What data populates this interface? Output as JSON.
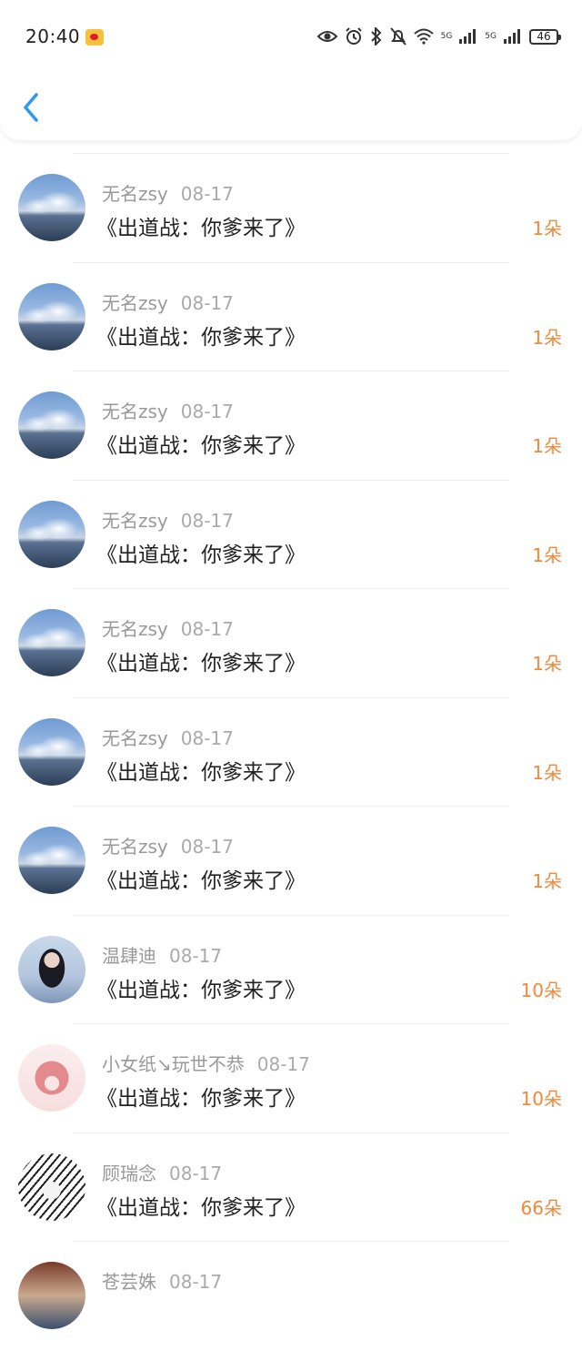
{
  "status_bar": {
    "time": "20:40",
    "network_1": "5G",
    "network_2": "5G",
    "battery": "46"
  },
  "nav": {
    "back_icon": "chevron-left-icon"
  },
  "colors": {
    "accent": "#2a9af3",
    "count": "#f08a3c",
    "meta": "#999999",
    "title": "#222222"
  },
  "items": [
    {
      "name": "无名zsy",
      "date": "08-17",
      "title": "《出道战：你爹来了》",
      "count": "1朵"
    },
    {
      "name": "无名zsy",
      "date": "08-17",
      "title": "《出道战：你爹来了》",
      "count": "1朵"
    },
    {
      "name": "无名zsy",
      "date": "08-17",
      "title": "《出道战：你爹来了》",
      "count": "1朵"
    },
    {
      "name": "无名zsy",
      "date": "08-17",
      "title": "《出道战：你爹来了》",
      "count": "1朵"
    },
    {
      "name": "无名zsy",
      "date": "08-17",
      "title": "《出道战：你爹来了》",
      "count": "1朵"
    },
    {
      "name": "无名zsy",
      "date": "08-17",
      "title": "《出道战：你爹来了》",
      "count": "1朵"
    },
    {
      "name": "无名zsy",
      "date": "08-17",
      "title": "《出道战：你爹来了》",
      "count": "1朵"
    },
    {
      "name": "温肆迪",
      "date": "08-17",
      "title": "《出道战：你爹来了》",
      "count": "10朵"
    },
    {
      "name": "小女纸↘玩世不恭",
      "date": "08-17",
      "title": "《出道战：你爹来了》",
      "count": "10朵"
    },
    {
      "name": "顾瑞念",
      "date": "08-17",
      "title": "《出道战：你爹来了》",
      "count": "66朵"
    },
    {
      "name": "苍芸姝",
      "date": "08-17",
      "title": "",
      "count": ""
    }
  ]
}
